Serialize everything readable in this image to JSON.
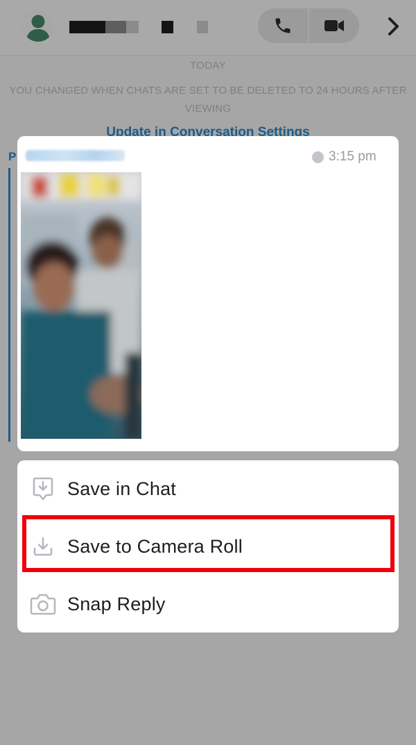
{
  "header": {
    "avatar_icon": "person-silhouette-icon",
    "contact_name_redacted": true,
    "call_icon": "phone-icon",
    "video_icon": "video-camera-icon",
    "forward_icon": "chevron-right-icon"
  },
  "chat": {
    "day_label": "TODAY",
    "notice": "YOU CHANGED WHEN CHATS ARE SET TO BE DELETED TO 24 HOURS AFTER VIEWING",
    "notice_link": "Update in Conversation Settings",
    "left_initial": "P"
  },
  "message": {
    "sender_redacted": true,
    "time": "3:15 pm",
    "media": "blurred-snap-photo"
  },
  "actions": [
    {
      "label": "Save in Chat",
      "icon": "save-in-chat-icon"
    },
    {
      "label": "Save to Camera Roll",
      "icon": "download-tray-icon",
      "highlighted": true
    },
    {
      "label": "Snap Reply",
      "icon": "camera-icon"
    }
  ],
  "colors": {
    "overlay": "#a6a6a6",
    "card": "#ffffff",
    "link": "#1f5a86",
    "highlight": "#f0000a",
    "icon_gray": "#b3b7bc"
  }
}
